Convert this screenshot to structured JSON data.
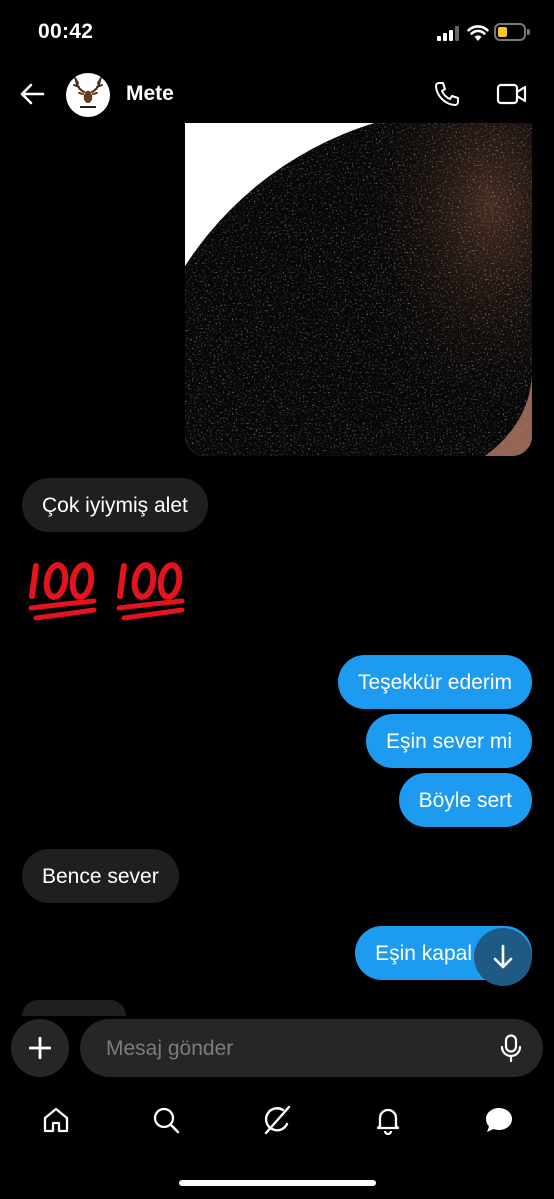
{
  "status_bar": {
    "time": "00:42",
    "battery_level": 0.25,
    "battery_color": "#f3c623"
  },
  "header": {
    "contact_name": "Mete",
    "back_icon": "arrow-left-icon",
    "call_icon": "phone-icon",
    "video_icon": "video-camera-icon"
  },
  "messages": [
    {
      "type": "image",
      "from": "them"
    },
    {
      "type": "text",
      "from": "them",
      "text": "Çok iyiymiş alet"
    },
    {
      "type": "emoji",
      "from": "them",
      "text": "💯💯"
    },
    {
      "type": "text",
      "from": "me",
      "text": "Teşekkür ederim"
    },
    {
      "type": "text",
      "from": "me",
      "text": "Eşin sever mi"
    },
    {
      "type": "text",
      "from": "me",
      "text": "Böyle sert"
    },
    {
      "type": "text",
      "from": "them",
      "text": "Bence sever"
    },
    {
      "type": "text",
      "from": "me",
      "text": "Eşin kapal"
    }
  ],
  "composer": {
    "placeholder": "Mesaj gönder",
    "add_icon": "plus-icon",
    "mic_icon": "microphone-icon"
  },
  "scroll_to_bottom_icon": "arrow-down-icon",
  "tab_bar": {
    "items": [
      "home-icon",
      "search-icon",
      "grok-icon",
      "bell-icon",
      "messages-icon"
    ]
  },
  "colors": {
    "sent_bubble": "#1d9bf0",
    "received_bubble": "#1f1f1f",
    "background": "#000000"
  }
}
